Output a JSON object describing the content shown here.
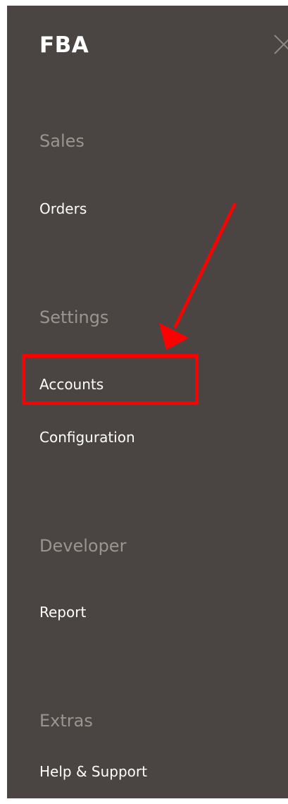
{
  "panel": {
    "title": "FBA",
    "close_icon": "close-icon"
  },
  "sections": [
    {
      "heading": "Sales",
      "items": [
        {
          "label": "Orders"
        }
      ]
    },
    {
      "heading": "Settings",
      "items": [
        {
          "label": "Accounts",
          "highlighted": true
        },
        {
          "label": "Configuration"
        }
      ]
    },
    {
      "heading": "Developer",
      "items": [
        {
          "label": "Report"
        }
      ]
    },
    {
      "heading": "Extras",
      "items": [
        {
          "label": "Help & Support"
        }
      ]
    }
  ],
  "annotation": {
    "color": "#ff0000",
    "arrow_icon": "arrow-icon",
    "target": "Accounts"
  },
  "colors": {
    "panel_background": "#4a4542",
    "section_heading": "#9a9591",
    "menu_item": "#ffffff"
  }
}
